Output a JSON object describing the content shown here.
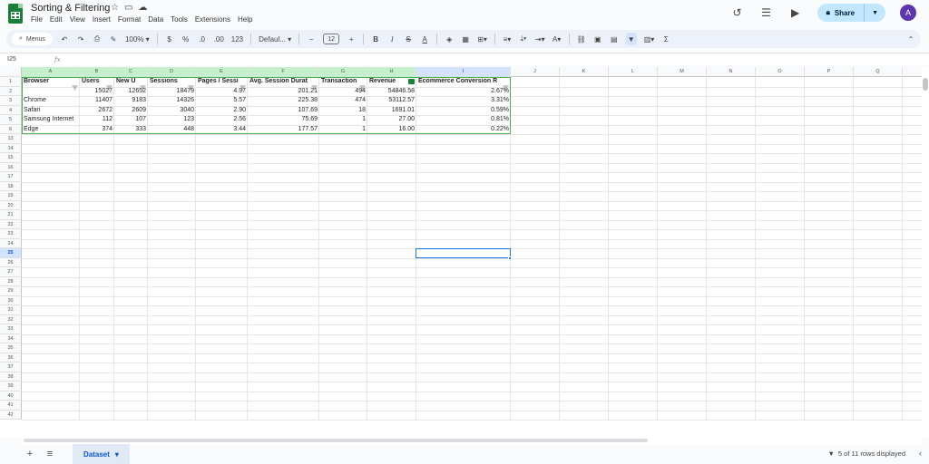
{
  "window": {
    "title": "Sorting & Filtering"
  },
  "menu": [
    "File",
    "Edit",
    "View",
    "Insert",
    "Format",
    "Data",
    "Tools",
    "Extensions",
    "Help"
  ],
  "header": {
    "share_label": "Share",
    "avatar_letter": "A"
  },
  "toolbar": {
    "menus_label": "Menus",
    "zoom": "100%",
    "currency": "$",
    "percent": "%",
    "dec_decrease": ".0",
    "dec_increase": ".00",
    "number_format": "123",
    "font": "Defaul...",
    "font_size": "12",
    "bold": "B",
    "italic": "I",
    "strike": "S",
    "text_color": "A",
    "sum": "Σ"
  },
  "formula_bar": {
    "cell_ref": "I25",
    "fx": "fx",
    "value": ""
  },
  "columns": [
    "A",
    "B",
    "C",
    "D",
    "E",
    "F",
    "G",
    "H",
    "I",
    "J",
    "K",
    "L",
    "M",
    "N",
    "O",
    "P",
    "Q"
  ],
  "visible_rows": [
    1,
    2,
    3,
    4,
    5,
    6,
    13,
    14,
    15,
    16,
    17,
    18,
    19,
    20,
    21,
    22,
    23,
    24,
    25,
    26,
    27,
    28,
    29,
    30,
    31,
    32,
    33,
    34,
    35,
    36,
    37,
    38,
    39,
    40,
    41,
    42
  ],
  "table": {
    "headers": [
      "Browser",
      "Users",
      "New U",
      "Sessions",
      "Pages / Sessi",
      "Avg. Session Durat",
      "Transaction",
      "Revenue",
      "Ecommerce Conversion R"
    ],
    "rows": [
      [
        "",
        "15027",
        "12652",
        "18479",
        "4.97",
        "201.21",
        "494",
        "54846.58",
        "2.67%"
      ],
      [
        "Chrome",
        "11407",
        "9183",
        "14326",
        "5.57",
        "225.38",
        "474",
        "53112.57",
        "3.31%"
      ],
      [
        "Safari",
        "2672",
        "2609",
        "3040",
        "2.90",
        "107.69",
        "18",
        "1691.01",
        "0.59%"
      ],
      [
        "Samsung Internet",
        "112",
        "107",
        "123",
        "2.56",
        "75.69",
        "1",
        "27.00",
        "0.81%"
      ],
      [
        "Edge",
        "374",
        "333",
        "448",
        "3.44",
        "177.57",
        "1",
        "16.00",
        "0.22%"
      ]
    ]
  },
  "selected_cell": "I25",
  "sheet": {
    "tab_name": "Dataset"
  },
  "status": {
    "text": "5 of 11 rows displayed"
  },
  "colors": {
    "accent": "#1a73e8",
    "sheets_green": "#188038",
    "share_bg": "#c2e7ff",
    "filter_green": "#4caf50"
  }
}
